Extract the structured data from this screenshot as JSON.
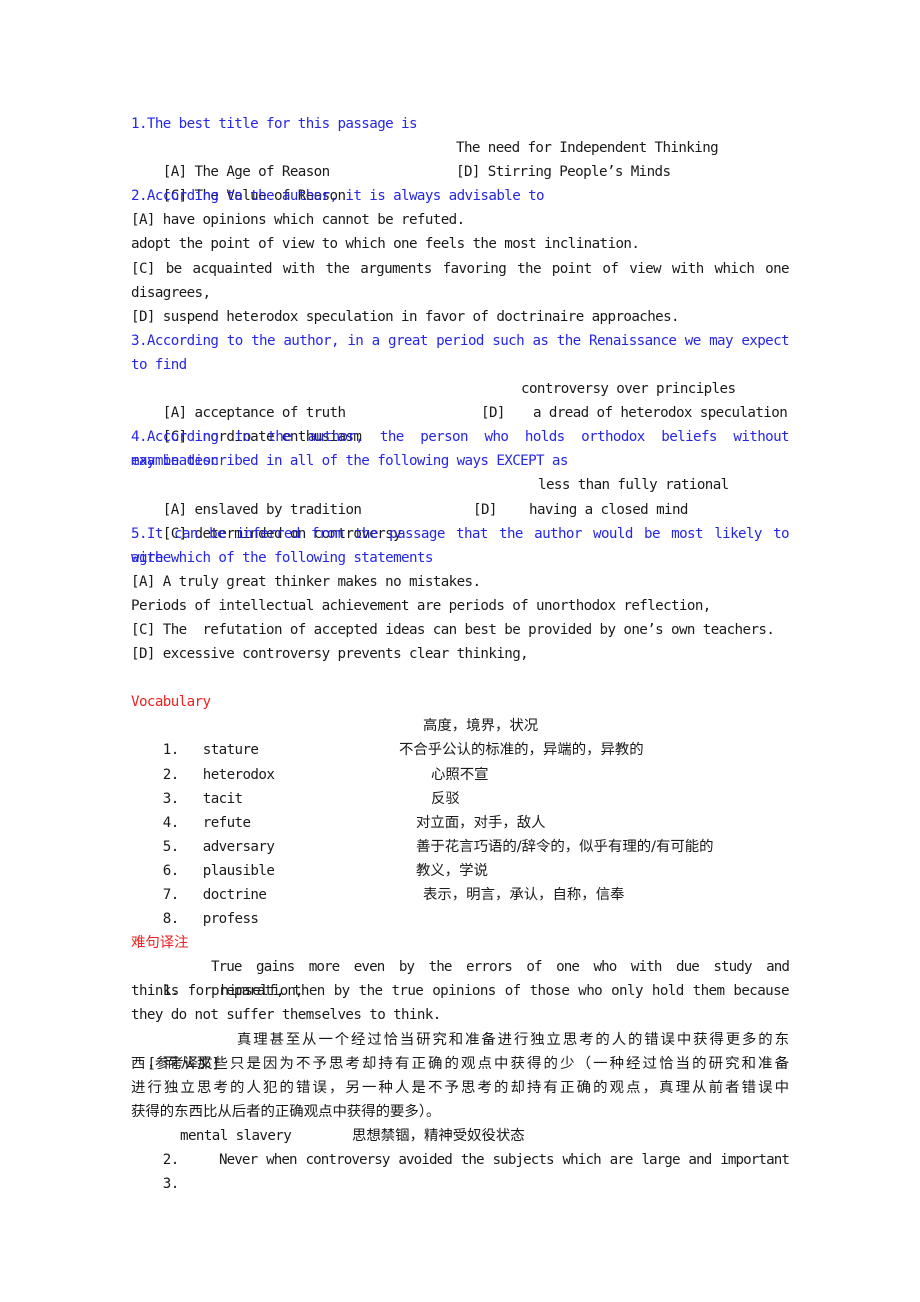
{
  "questions": [
    {
      "prompt": "1.The best title for this passage is",
      "options": {
        "a": "[A] The Age of Reason",
        "b": "The need for Independent Thinking",
        "c": "[C] The Value of Reason",
        "d": "[D] Stirring People’s Minds"
      }
    },
    {
      "prompt": "2.According to the author, it is always advisable to",
      "options": {
        "a": "[A] have opinions which cannot be refuted.",
        "b": "adopt the point of view to which one feels the most inclination.",
        "c_line1": "[C] be acquainted with the arguments favoring the point of view with which one",
        "c_line2": "disagrees,",
        "d": "[D] suspend heterodox speculation in favor of doctrinaire approaches."
      }
    },
    {
      "prompt_line1": "3.According to the author, in a great period such as the Renaissance we may expect",
      "prompt_line2": "to find",
      "options": {
        "a": "[A] acceptance of truth",
        "b": "controversy over principles",
        "c": "[C] inordinate enthusiasm",
        "d_label": "[D]",
        "d": "a dread of heterodox speculation"
      }
    },
    {
      "prompt_line1": "4.According to the author, the person who holds orthodox beliefs without examination",
      "prompt_line2": "may be described in all of the following ways EXCEPT as",
      "options": {
        "a": "[A] enslaved by tradition",
        "b": "less than fully rational",
        "c": "[C] determinded on controversy",
        "d_label": "[D]",
        "d": "having a closed mind"
      }
    },
    {
      "prompt_line1": "5.It can be inferred from the passage that the author would be most likely to agree",
      "prompt_line2": "with which of the following statements",
      "options": {
        "a": "[A] A truly great thinker makes no mistakes.",
        "b": "Periods of intellectual achievement are periods of unorthodox reflection,",
        "c": "[C] The  refutation of accepted ideas can best be provided by one’s own teachers.",
        "d": "[D] excessive controversy prevents clear thinking,"
      }
    }
  ],
  "vocabulary": {
    "heading": "Vocabulary",
    "items": [
      {
        "num": "1.",
        "term": "stature",
        "meaning": "高度，境界，状况"
      },
      {
        "num": "2.",
        "term": "heterodox",
        "meaning": "不合乎公认的标准的，异端的，异教的"
      },
      {
        "num": "3.",
        "term": "tacit",
        "meaning": "心照不宣"
      },
      {
        "num": "4.",
        "term": "refute",
        "meaning": "反驳"
      },
      {
        "num": "5.",
        "term": "adversary",
        "meaning": "对立面，对手，敌人"
      },
      {
        "num": "6.",
        "term": "plausible",
        "meaning": "善于花言巧语的/辞令的，似乎有理的/有可能的"
      },
      {
        "num": "7.",
        "term": "doctrine",
        "meaning": "教义，学说"
      },
      {
        "num": "8.",
        "term": "profess",
        "meaning": "表示，明言，承认，自称，信奉"
      }
    ]
  },
  "difficult_sentences": {
    "heading": "难句译注",
    "items": [
      {
        "num": "1.",
        "line1": "True gains more even by the errors of one who with due study and preparation,",
        "line2": "thinks for himself, then by the true opinions of those who only hold them because",
        "line3": "they do not suffer themselves to think.",
        "ref_label": "[参考译文]",
        "ref_line1": "真理甚至从一个经过恰当研究和准备进行独立思考的人的错误中获得更多的东",
        "ref_line2": "西，而从那些只是因为不予思考却持有正确的观点中获得的少（一种经过恰当的研究和准备",
        "ref_line3": "进行独立思考的人犯的错误，另一种人是不予思考的却持有正确的观点，真理从前者错误中",
        "ref_line4": "获得的东西比从后者的正确观点中获得的要多）。"
      },
      {
        "num": "2.",
        "term": "mental slavery",
        "meaning": "思想禁锢，精神受奴役状态"
      },
      {
        "num": "3.",
        "line1": "Never when controversy avoided the subjects which are large and important"
      }
    ]
  },
  "colors": {
    "question": "#2626e6",
    "section_heading": "#ee2222",
    "body_text": "#1a1a1a"
  }
}
